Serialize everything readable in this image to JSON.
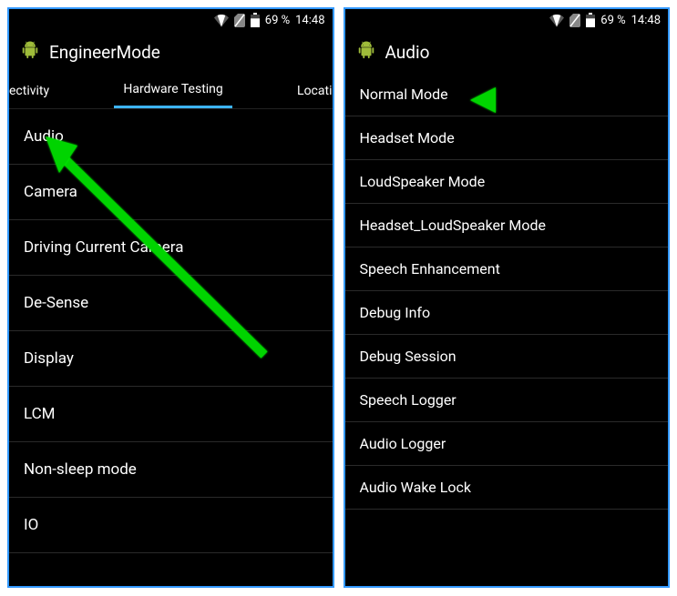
{
  "status": {
    "battery_percent": "69 %",
    "time": "14:48"
  },
  "screen1": {
    "app_title": "EngineerMode",
    "tabs": {
      "left_partial": "ectivity",
      "active": "Hardware Testing",
      "right_partial": "Locati"
    },
    "list": [
      "Audio",
      "Camera",
      "Driving Current Camera",
      "De-Sense",
      "Display",
      "LCM",
      "Non-sleep mode",
      "IO"
    ]
  },
  "screen2": {
    "app_title": "Audio",
    "list": [
      "Normal Mode",
      "Headset Mode",
      "LoudSpeaker Mode",
      "Headset_LoudSpeaker Mode",
      "Speech Enhancement",
      "Debug Info",
      "Debug Session",
      "Speech Logger",
      "Audio Logger",
      "Audio Wake Lock"
    ]
  }
}
